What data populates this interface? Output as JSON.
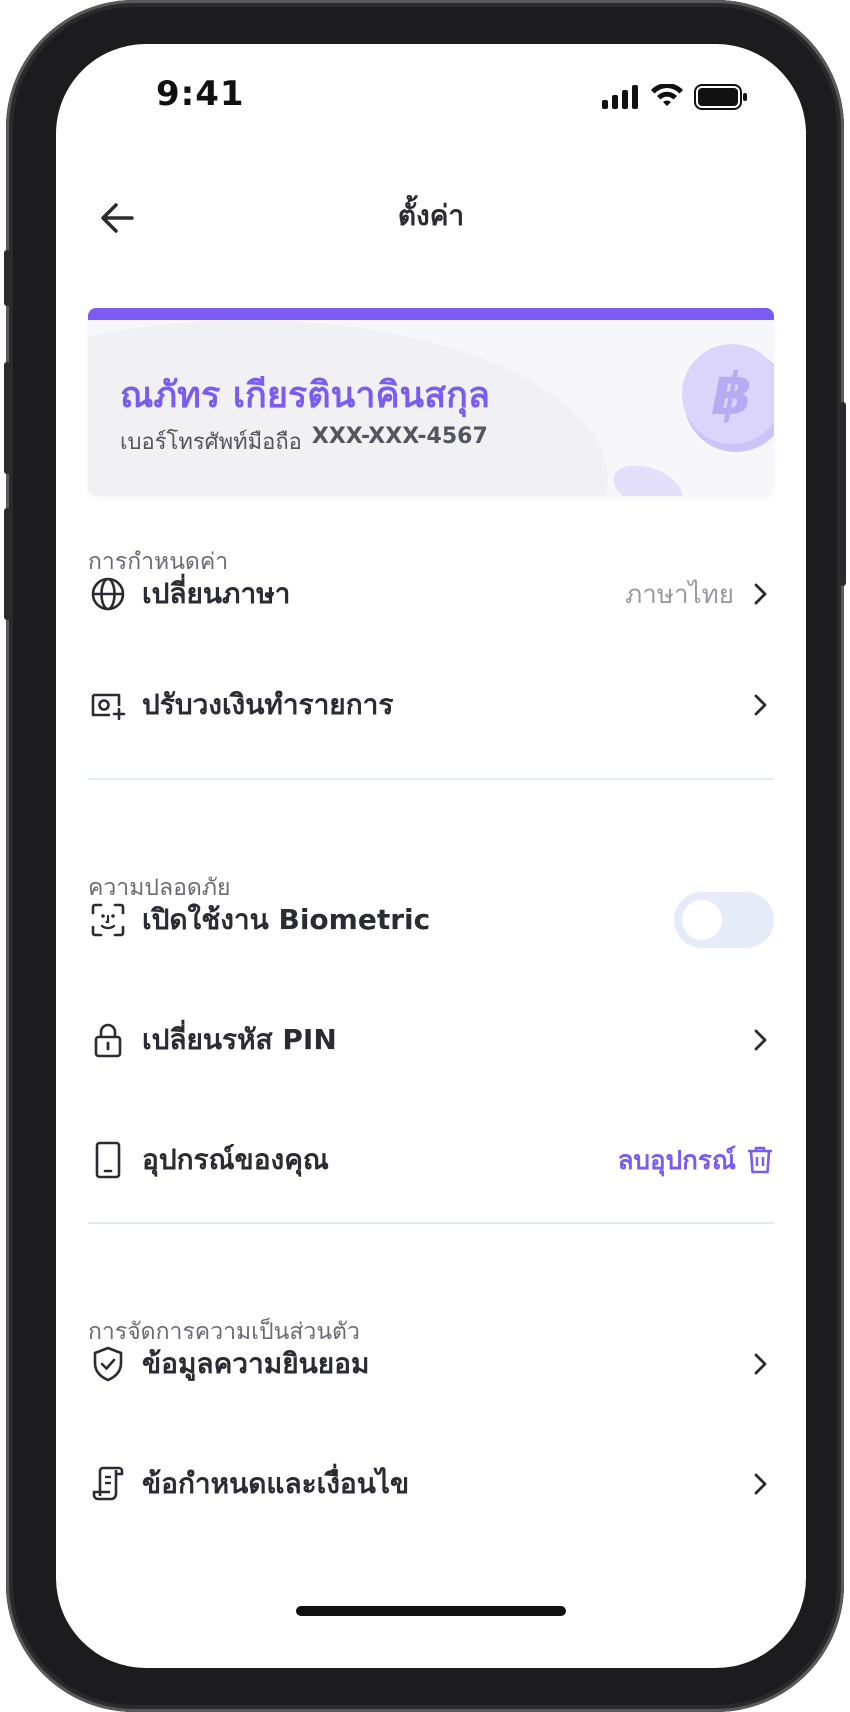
{
  "status_bar": {
    "time": "9:41"
  },
  "header": {
    "title": "ตั้งค่า"
  },
  "profile": {
    "name": "ณภัทร เกียรตินาคินสกุล",
    "phone_label": "เบอร์โทรศัพท์มือถือ",
    "phone_value": "XXX-XXX-4567"
  },
  "sections": {
    "settings": {
      "heading": "การกำหนดค่า",
      "language_label": "เปลี่ยนภาษา",
      "language_value": "ภาษาไทย",
      "limit_label": "ปรับวงเงินทำรายการ"
    },
    "security": {
      "heading": "ความปลอดภัย",
      "biometric_label": "เปิดใช้งาน Biometric",
      "biometric_enabled": false,
      "pin_label": "เปลี่ยนรหัส PIN",
      "device_label": "อุปกรณ์ของคุณ",
      "remove_device_label": "ลบอุปกรณ์"
    },
    "privacy": {
      "heading": "การจัดการความเป็นส่วนตัว",
      "consent_label": "ข้อมูลความยินยอม",
      "terms_label": "ข้อกำหนดและเงื่อนไข"
    }
  },
  "colors": {
    "accent": "#7b5cf0",
    "text": "#2b2b33",
    "muted": "#9a9aa3",
    "divider": "#e3ecf2",
    "toggle_off": "#e6ebf8"
  }
}
